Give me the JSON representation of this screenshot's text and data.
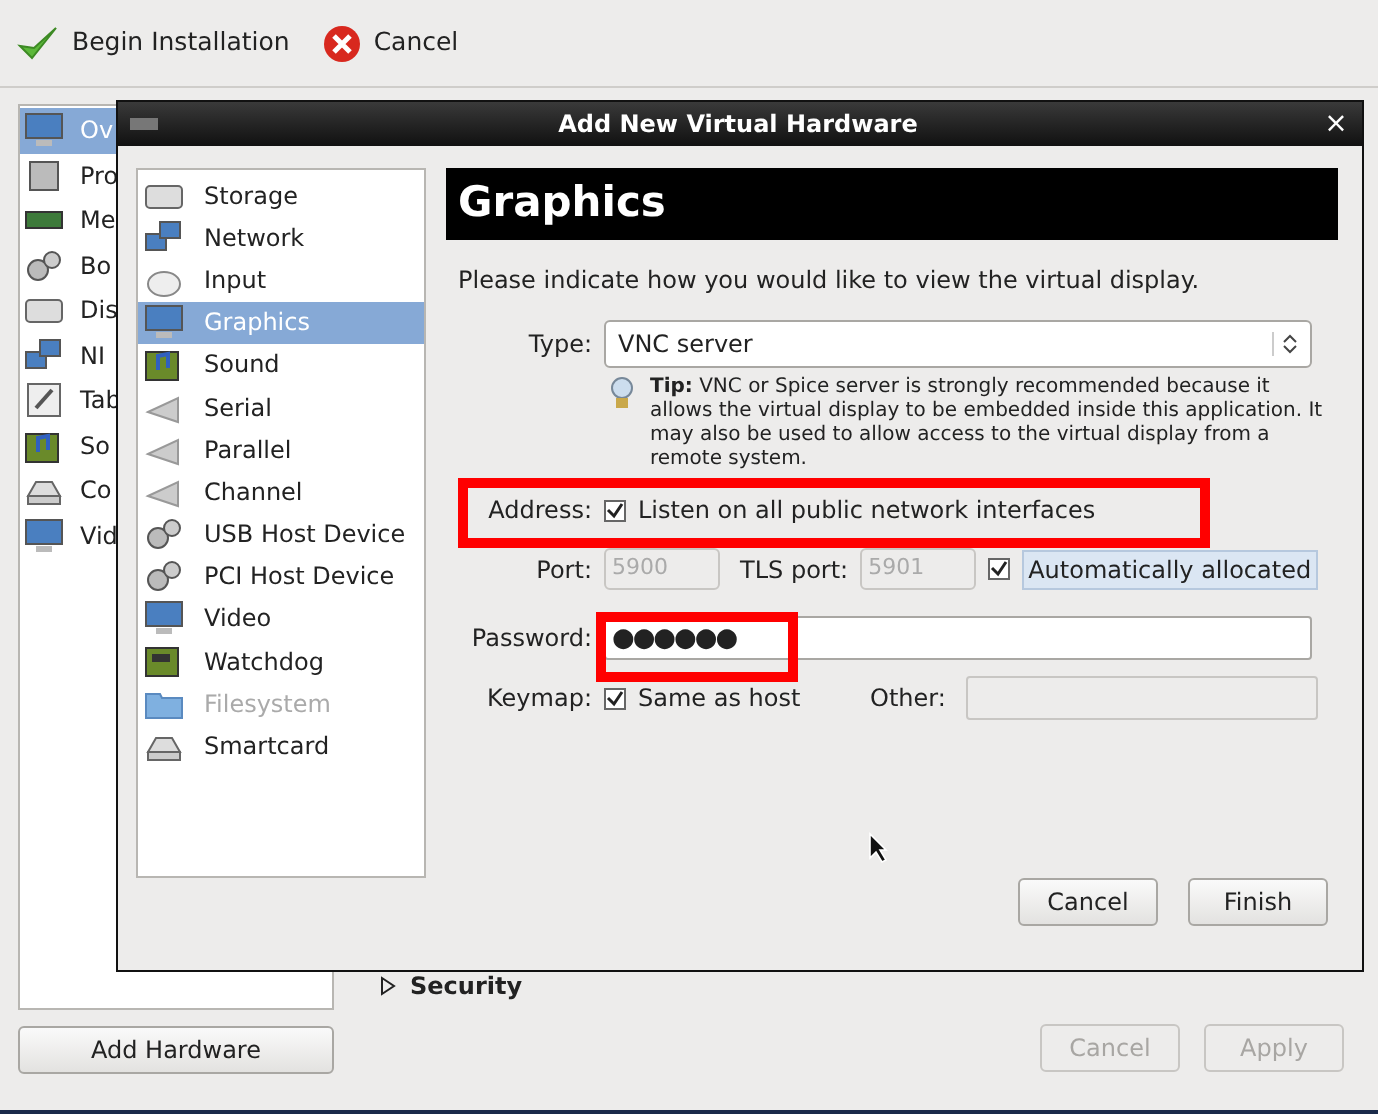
{
  "toolbar": {
    "buttons": [
      {
        "label": "Begin Installation",
        "kind": "check"
      },
      {
        "label": "Cancel",
        "kind": "cancel"
      }
    ]
  },
  "sidebar": {
    "items": [
      {
        "label": "Ov",
        "selected": true
      },
      {
        "label": "Pro",
        "selected": false
      },
      {
        "label": "Me",
        "selected": false
      },
      {
        "label": "Bo",
        "selected": false
      },
      {
        "label": "Dis",
        "selected": false
      },
      {
        "label": "NI",
        "selected": false
      },
      {
        "label": "Tab",
        "selected": false
      },
      {
        "label": "So",
        "selected": false
      },
      {
        "label": "Co",
        "selected": false
      },
      {
        "label": "Vid",
        "selected": false
      }
    ]
  },
  "add_hardware_button": "Add Hardware",
  "security_expander": {
    "label": "Security",
    "expanded": false
  },
  "bottom_buttons": [
    {
      "label": "Cancel",
      "disabled": true
    },
    {
      "label": "Apply",
      "disabled": true
    }
  ],
  "dialog": {
    "title": "Add New Virtual Hardware",
    "close": "×",
    "hardware_list": [
      {
        "label": "Storage",
        "selected": false,
        "disabled": false
      },
      {
        "label": "Network",
        "selected": false,
        "disabled": false
      },
      {
        "label": "Input",
        "selected": false,
        "disabled": false
      },
      {
        "label": "Graphics",
        "selected": true,
        "disabled": false
      },
      {
        "label": "Sound",
        "selected": false,
        "disabled": false
      },
      {
        "label": "Serial",
        "selected": false,
        "disabled": false
      },
      {
        "label": "Parallel",
        "selected": false,
        "disabled": false
      },
      {
        "label": "Channel",
        "selected": false,
        "disabled": false
      },
      {
        "label": "USB Host Device",
        "selected": false,
        "disabled": false
      },
      {
        "label": "PCI Host Device",
        "selected": false,
        "disabled": false
      },
      {
        "label": "Video",
        "selected": false,
        "disabled": false
      },
      {
        "label": "Watchdog",
        "selected": false,
        "disabled": false
      },
      {
        "label": "Filesystem",
        "selected": false,
        "disabled": true
      },
      {
        "label": "Smartcard",
        "selected": false,
        "disabled": false
      }
    ],
    "heading": "Graphics",
    "intro": "Please indicate how you would like to view the virtual display.",
    "type": {
      "label": "Type:",
      "value": "VNC server"
    },
    "tip": "**Tip:** VNC or Spice server is strongly recommended because it allows the virtual display to be embedded inside this application. It may also be used to allow access to the virtual display from a remote system.",
    "address": {
      "label": "Address:",
      "checkbox": "Listen on all public network interfaces",
      "checked": true
    },
    "port": {
      "label": "Port:",
      "value": "5900",
      "disabled": true
    },
    "tls_port": {
      "label": "TLS port:",
      "value": "5901",
      "disabled": true
    },
    "auto_allocated": {
      "label": "Automatically allocated",
      "checked": true
    },
    "password": {
      "label": "Password:",
      "value": "●●●●●●"
    },
    "keymap": {
      "label": "Keymap:",
      "checkbox": "Same as host",
      "checked": true
    },
    "other": {
      "label": "Other:",
      "disabled": true
    },
    "buttons": [
      {
        "label": "Cancel",
        "disabled": false
      },
      {
        "label": "Finish",
        "disabled": false
      }
    ]
  }
}
